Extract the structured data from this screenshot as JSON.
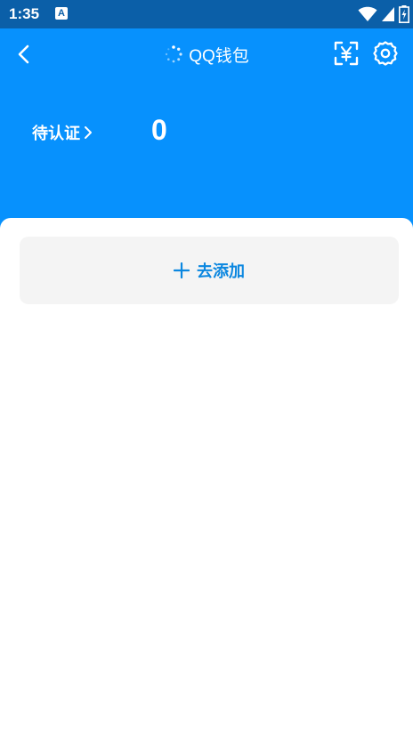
{
  "status_bar": {
    "time": "1:35",
    "notification_icon": "a-icon",
    "icons": [
      "wifi-icon",
      "signal-icon",
      "battery-charging-icon"
    ]
  },
  "header": {
    "title": "QQ钱包",
    "back_icon": "back-chevron-icon",
    "loading_icon": "loading-spinner-icon",
    "actions": [
      "scan-yuan-icon",
      "gear-icon"
    ]
  },
  "account": {
    "verify_label": "待认证",
    "balance": "0"
  },
  "add_card": {
    "label": "去添加"
  },
  "colors": {
    "header_bg": "#0791fd",
    "status_bg": "#0b5fa8",
    "accent": "#0b87e0",
    "card_bg": "#f4f4f4"
  }
}
